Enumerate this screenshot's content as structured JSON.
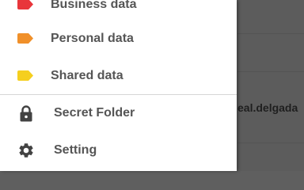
{
  "background": {
    "partial_email_text": "eal.delgada"
  },
  "drawer": {
    "labels": [
      {
        "label": "Business data",
        "icon": "tag-icon",
        "color": "#e8363b"
      },
      {
        "label": "Personal data",
        "icon": "tag-icon",
        "color": "#f0902a"
      },
      {
        "label": "Shared data",
        "icon": "tag-icon",
        "color": "#f5cf1f"
      }
    ],
    "utilities": [
      {
        "label": "Secret Folder",
        "icon": "lock-icon"
      },
      {
        "label": "Setting",
        "icon": "gear-icon"
      }
    ]
  }
}
